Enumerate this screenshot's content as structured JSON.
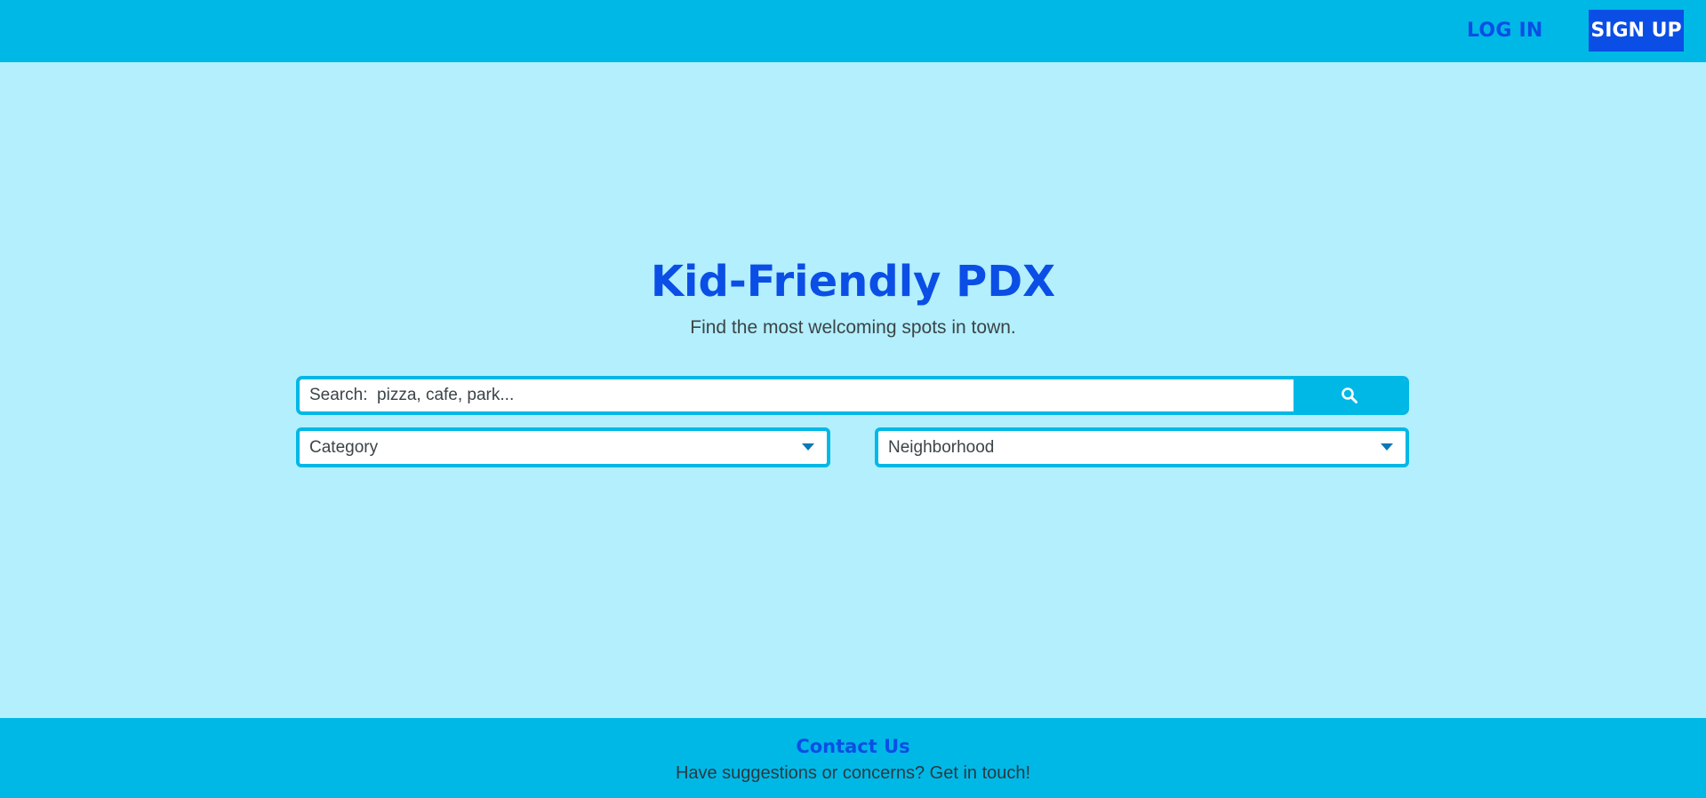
{
  "header": {
    "login_label": "LOG IN",
    "signup_label": "SIGN UP"
  },
  "hero": {
    "title": "Kid-Friendly PDX",
    "subtitle": "Find the most welcoming spots in town."
  },
  "search": {
    "placeholder": "Search:  pizza, cafe, park...",
    "button_icon": "search-icon"
  },
  "filters": {
    "category": {
      "selected": "Category",
      "icon": "chevron-down-icon"
    },
    "neighborhood": {
      "selected": "Neighborhood",
      "icon": "chevron-down-icon"
    }
  },
  "footer": {
    "title": "Contact Us",
    "text": "Have suggestions or concerns? Get in touch!"
  },
  "colors": {
    "page_background": "#b3effc",
    "bar_background": "#00b8e6",
    "brand_blue": "#0b4ee6",
    "text_gray": "#3b4448",
    "caret_blue": "#0a79b8"
  }
}
